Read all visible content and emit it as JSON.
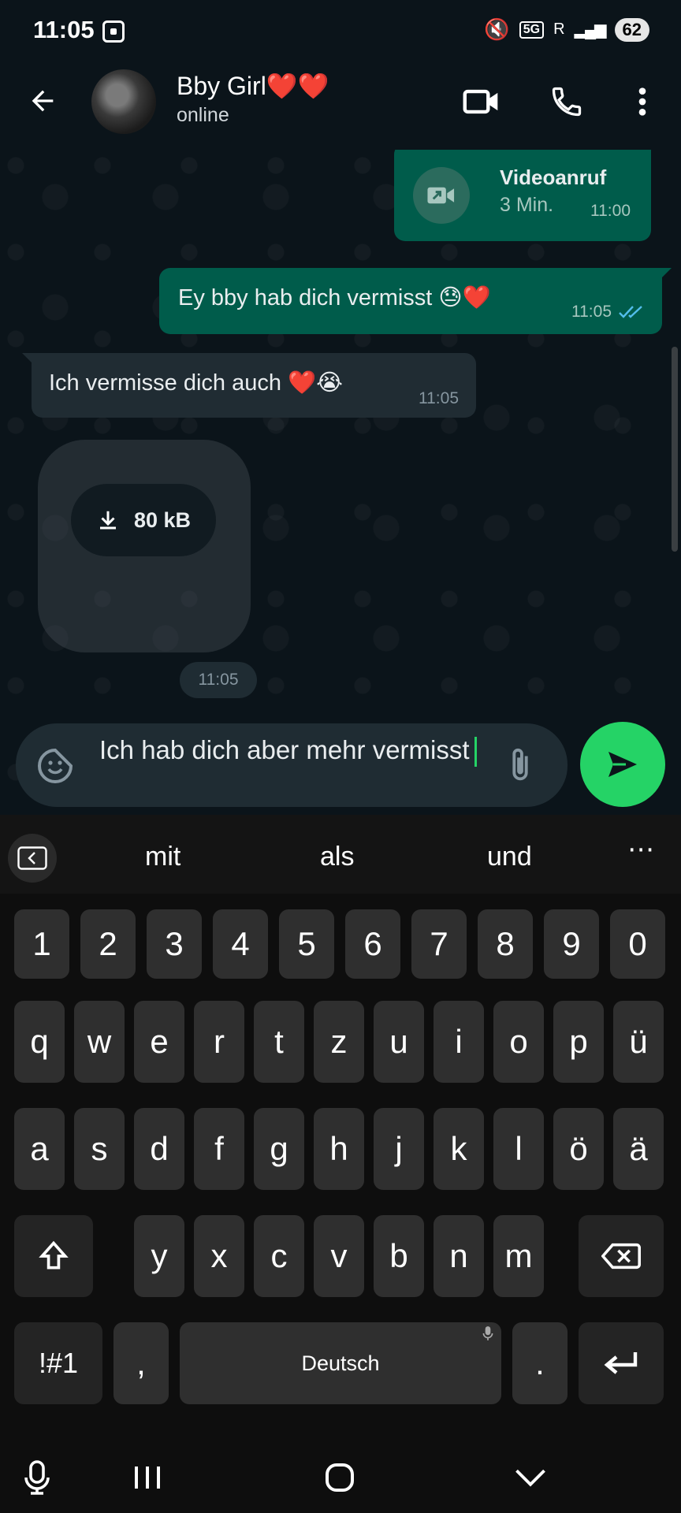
{
  "status_bar": {
    "time": "11:05",
    "network": "5G",
    "roaming": "R",
    "battery": "62"
  },
  "header": {
    "contact_name": "Bby Girl❤️❤️",
    "contact_status": "online"
  },
  "messages": {
    "video_call": {
      "title": "Videoanruf",
      "duration": "3 Min.",
      "time": "11:00"
    },
    "outgoing_1": {
      "text": "Ey bby hab dich vermisst 😓❤️",
      "time": "11:05"
    },
    "incoming_1": {
      "text": "Ich vermisse dich auch ❤️😭",
      "time": "11:05"
    },
    "sticker": {
      "size": "80 kB",
      "time": "11:05"
    }
  },
  "composer": {
    "text": "Ich hab dich aber mehr vermisst"
  },
  "keyboard": {
    "suggestions": [
      "mit",
      "als",
      "und"
    ],
    "rows": [
      [
        "1",
        "2",
        "3",
        "4",
        "5",
        "6",
        "7",
        "8",
        "9",
        "0"
      ],
      [
        "q",
        "w",
        "e",
        "r",
        "t",
        "z",
        "u",
        "i",
        "o",
        "p",
        "ü"
      ],
      [
        "a",
        "s",
        "d",
        "f",
        "g",
        "h",
        "j",
        "k",
        "l",
        "ö",
        "ä"
      ],
      [
        "y",
        "x",
        "c",
        "v",
        "b",
        "n",
        "m"
      ]
    ],
    "symbols_key": "!#1",
    "comma_key": ",",
    "space_label": "Deutsch",
    "period_key": "."
  },
  "colors": {
    "accent": "#25d366",
    "outgoing_bubble": "#005c4b",
    "incoming_bubble": "#202c33",
    "read_ticks": "#53bdeb"
  }
}
